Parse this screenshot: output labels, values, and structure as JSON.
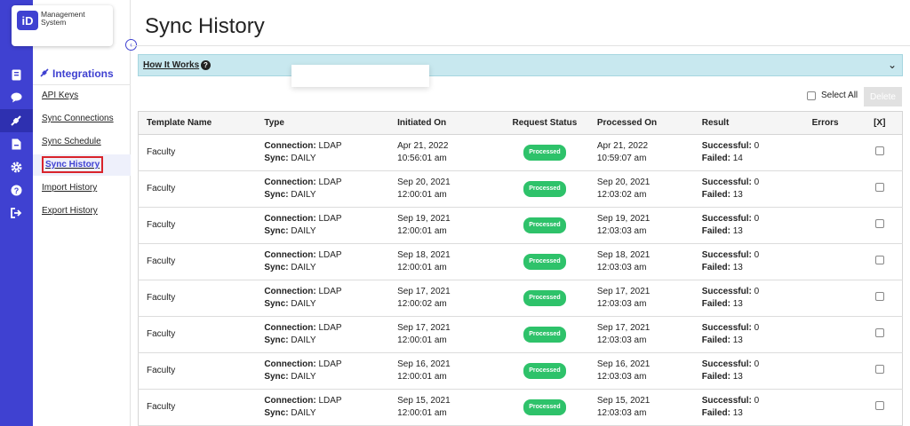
{
  "logo": {
    "mark": "iD",
    "line1": "Management",
    "line2": "System"
  },
  "collapse_glyph": "‹",
  "rail_icons": [
    "report-icon",
    "chat-icon",
    "integrations-icon",
    "document-icon",
    "settings-icon",
    "help-icon",
    "logout-icon"
  ],
  "sidebar": {
    "section_title": "Integrations",
    "items": [
      {
        "label": "API Keys"
      },
      {
        "label": "Sync Connections"
      },
      {
        "label": "Sync Schedule"
      },
      {
        "label": "Sync History"
      },
      {
        "label": "Import History"
      },
      {
        "label": "Export History"
      }
    ]
  },
  "page": {
    "title": "Sync History"
  },
  "how_it_works": {
    "label": "How It Works",
    "chevron": "⌄"
  },
  "toolbar": {
    "select_all_label": "Select All",
    "delete_label": "Delete"
  },
  "table": {
    "headers": {
      "template_name": "Template Name",
      "type": "Type",
      "initiated_on": "Initiated On",
      "request_status": "Request Status",
      "processed_on": "Processed On",
      "result": "Result",
      "errors": "Errors",
      "x": "[X]"
    },
    "labels": {
      "connection": "Connection:",
      "sync": "Sync:",
      "successful": "Successful:",
      "failed": "Failed:"
    },
    "rows": [
      {
        "template": "Faculty",
        "connection": "LDAP",
        "sync": "DAILY",
        "init_date": "Apr 21, 2022",
        "init_time": "10:56:01 am",
        "status": "Processed",
        "proc_date": "Apr 21, 2022",
        "proc_time": "10:59:07 am",
        "successful": "0",
        "failed": "14",
        "errors": ""
      },
      {
        "template": "Faculty",
        "connection": "LDAP",
        "sync": "DAILY",
        "init_date": "Sep 20, 2021",
        "init_time": "12:00:01 am",
        "status": "Processed",
        "proc_date": "Sep 20, 2021",
        "proc_time": "12:03:02 am",
        "successful": "0",
        "failed": "13",
        "errors": ""
      },
      {
        "template": "Faculty",
        "connection": "LDAP",
        "sync": "DAILY",
        "init_date": "Sep 19, 2021",
        "init_time": "12:00:01 am",
        "status": "Processed",
        "proc_date": "Sep 19, 2021",
        "proc_time": "12:03:03 am",
        "successful": "0",
        "failed": "13",
        "errors": ""
      },
      {
        "template": "Faculty",
        "connection": "LDAP",
        "sync": "DAILY",
        "init_date": "Sep 18, 2021",
        "init_time": "12:00:01 am",
        "status": "Processed",
        "proc_date": "Sep 18, 2021",
        "proc_time": "12:03:03 am",
        "successful": "0",
        "failed": "13",
        "errors": ""
      },
      {
        "template": "Faculty",
        "connection": "LDAP",
        "sync": "DAILY",
        "init_date": "Sep 17, 2021",
        "init_time": "12:00:02 am",
        "status": "Processed",
        "proc_date": "Sep 17, 2021",
        "proc_time": "12:03:03 am",
        "successful": "0",
        "failed": "13",
        "errors": ""
      },
      {
        "template": "Faculty",
        "connection": "LDAP",
        "sync": "DAILY",
        "init_date": "Sep 17, 2021",
        "init_time": "12:00:01 am",
        "status": "Processed",
        "proc_date": "Sep 17, 2021",
        "proc_time": "12:03:03 am",
        "successful": "0",
        "failed": "13",
        "errors": ""
      },
      {
        "template": "Faculty",
        "connection": "LDAP",
        "sync": "DAILY",
        "init_date": "Sep 16, 2021",
        "init_time": "12:00:01 am",
        "status": "Processed",
        "proc_date": "Sep 16, 2021",
        "proc_time": "12:03:03 am",
        "successful": "0",
        "failed": "13",
        "errors": ""
      },
      {
        "template": "Faculty",
        "connection": "LDAP",
        "sync": "DAILY",
        "init_date": "Sep 15, 2021",
        "init_time": "12:00:01 am",
        "status": "Processed",
        "proc_date": "Sep 15, 2021",
        "proc_time": "12:03:03 am",
        "successful": "0",
        "failed": "13",
        "errors": ""
      }
    ]
  },
  "colors": {
    "brand": "#3f41d1",
    "success": "#2ec26a",
    "highlight_border": "#d9242b",
    "info_bar": "#c8e8ef"
  }
}
